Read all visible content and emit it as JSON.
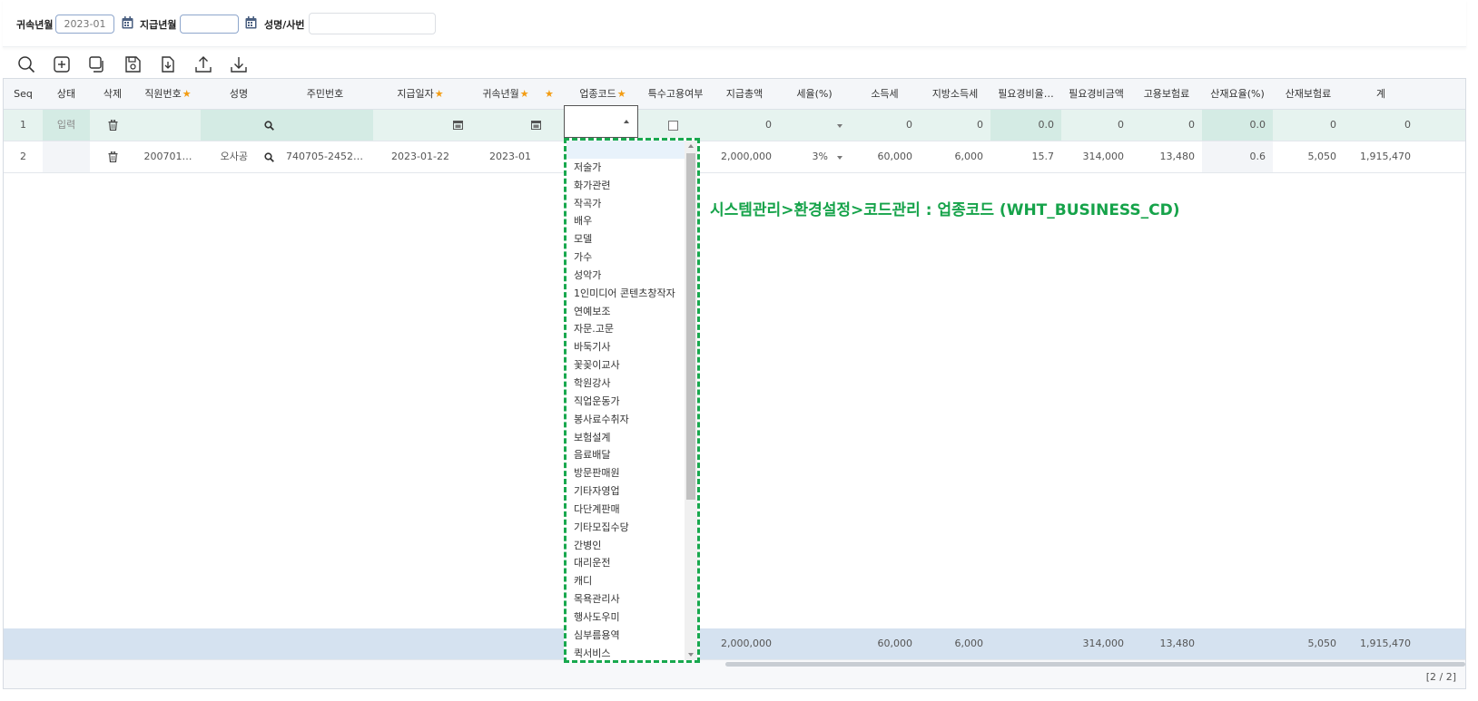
{
  "search": {
    "belong_ym_label": "귀속년월",
    "belong_ym_value": "2023-01",
    "pay_ym_label": "지급년월",
    "pay_ym_value": "",
    "name_label": "성명/사번",
    "name_value": ""
  },
  "toolbar": [
    "search-icon",
    "add-icon",
    "copy-icon",
    "save-icon",
    "import-icon",
    "upload-icon",
    "download-icon"
  ],
  "columns": {
    "seq": "Seq",
    "status": "상태",
    "delete": "삭제",
    "emp_no": "직원번호",
    "name": "성명",
    "resident_no": "주민번호",
    "pay_date": "지급일자",
    "belong_ym": "귀속년월",
    "biz_code": "업종코드",
    "special_emp": "특수고용여부",
    "total_pay": "지급총액",
    "tax_rate": "세율(%)",
    "income_tax": "소득세",
    "local_tax": "지방소득세",
    "exp_rate": "필요경비율…",
    "exp_amt": "필요경비금액",
    "emp_ins": "고용보험료",
    "ind_rate": "산재요율(%)",
    "ind_ins": "산재보험료",
    "total": "계"
  },
  "rows": [
    {
      "seq": "1",
      "status": "입력",
      "emp_no": "",
      "name": "",
      "resident_no": "",
      "pay_date": "",
      "belong_ym": "",
      "total_pay": "0",
      "tax_rate": "",
      "income_tax": "0",
      "local_tax": "0",
      "exp_rate": "0.0",
      "exp_amt": "0",
      "emp_ins": "0",
      "ind_rate": "0.0",
      "ind_ins": "0",
      "total": "0"
    },
    {
      "seq": "2",
      "status": "",
      "emp_no": "200701…",
      "name": "오사공",
      "resident_no": "740705-2452…",
      "pay_date": "2023-01-22",
      "belong_ym": "2023-01",
      "total_pay": "2,000,000",
      "tax_rate": "3%",
      "income_tax": "60,000",
      "local_tax": "6,000",
      "exp_rate": "15.7",
      "exp_amt": "314,000",
      "emp_ins": "13,480",
      "ind_rate": "0.6",
      "ind_ins": "5,050",
      "total": "1,915,470"
    }
  ],
  "summary": {
    "total_pay": "2,000,000",
    "income_tax": "60,000",
    "local_tax": "6,000",
    "exp_amt": "314,000",
    "emp_ins": "13,480",
    "ind_ins": "5,050",
    "total": "1,915,470"
  },
  "page_count": "[2 / 2]",
  "dropdown_items": [
    "",
    "저술가",
    "화가관련",
    "작곡가",
    "배우",
    "모델",
    "가수",
    "성악가",
    "1인미디어 콘텐츠창작자",
    "연예보조",
    "자문.고문",
    "바둑기사",
    "꽃꽂이교사",
    "학원강사",
    "직업운동가",
    "봉사료수취자",
    "보험설계",
    "음료배달",
    "방문판매원",
    "기타자영업",
    "다단계판매",
    "기타모집수당",
    "간병인",
    "대리운전",
    "캐디",
    "목욕관리사",
    "행사도우미",
    "심부름용역",
    "퀵서비스"
  ],
  "annotation": "시스템관리>환경설정>코드관리 : 업종코드 (WHT_BUSINESS_CD)",
  "colors": {
    "accent_green": "#16a34a",
    "input_row": "#e6f3ef",
    "summary_row": "#d5e2f0",
    "required_star": "#f39c12"
  }
}
